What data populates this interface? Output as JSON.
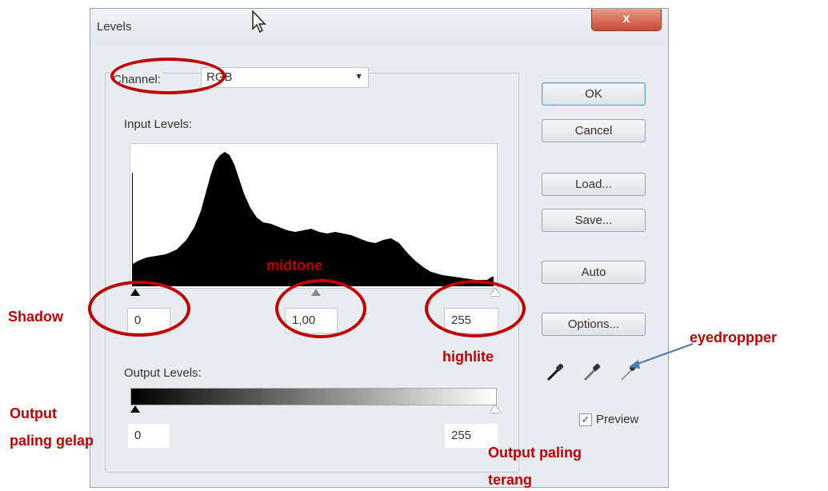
{
  "window": {
    "title": "Levels",
    "close_label": "x"
  },
  "channel": {
    "label": "Channel:",
    "value": "RGB"
  },
  "input_levels": {
    "label": "Input Levels:",
    "shadow": "0",
    "midtone": "1,00",
    "highlight": "255"
  },
  "output_levels": {
    "label": "Output Levels:",
    "dark": "0",
    "light": "255"
  },
  "buttons": {
    "ok": "OK",
    "cancel": "Cancel",
    "load": "Load...",
    "save": "Save...",
    "auto": "Auto",
    "options": "Options..."
  },
  "preview": {
    "label": "Preview",
    "checked": true,
    "check_glyph": "✓"
  },
  "annotations": {
    "midtone": "midtone",
    "shadow": "Shadow",
    "highlite": "highlite",
    "eyedropper": "eyedroppper",
    "output_dark_line1": "Output",
    "output_dark_line2": "paling gelap",
    "output_light_line1": "Output paling",
    "output_light_line2": "terang"
  },
  "icons": {
    "cursor": "arrow-cursor-icon",
    "eyedroppers": [
      "black-eyedropper-icon",
      "gray-eyedropper-icon",
      "white-eyedropper-icon"
    ]
  },
  "colors": {
    "annotation": "#c00000",
    "arrow": "#4a7ab8"
  }
}
